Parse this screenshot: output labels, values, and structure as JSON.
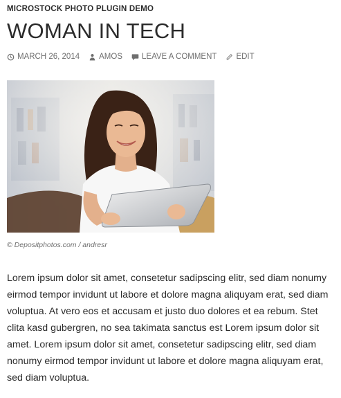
{
  "post": {
    "category": "MICROSTOCK PHOTO PLUGIN DEMO",
    "title": "WOMAN IN TECH",
    "meta": {
      "date": "MARCH 26, 2014",
      "author": "AMOS",
      "comment": "LEAVE A COMMENT",
      "edit": "EDIT"
    },
    "image": {
      "caption": "© Depositphotos.com / andresr"
    },
    "body": "Lorem ipsum dolor sit amet, consetetur sadipscing elitr, sed diam nonumy eirmod tempor invidunt ut labore et dolore magna aliquyam erat, sed diam voluptua. At vero eos et accusam et justo duo dolores et ea rebum. Stet clita kasd gubergren, no sea takimata sanctus est Lorem ipsum dolor sit amet. Lorem ipsum dolor sit amet, consetetur sadipscing elitr, sed diam nonumy eirmod tempor invidunt ut labore et dolore magna aliquyam erat, sed diam voluptua."
  },
  "colors": {
    "text": "#2b2b2b",
    "meta": "#6f6f6f"
  }
}
